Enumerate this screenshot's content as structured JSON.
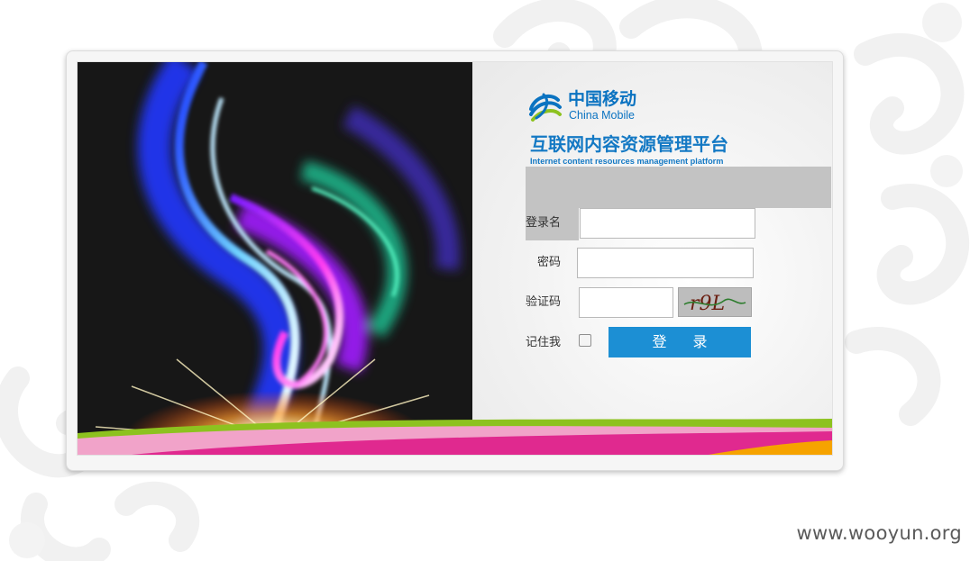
{
  "brand": {
    "name_cn": "中国移动",
    "name_en": "China Mobile"
  },
  "platform": {
    "title_cn": "互联网内容资源管理平台",
    "title_en": "Internet content resources management platform"
  },
  "form": {
    "username_label": "登录名",
    "username_value": "",
    "password_label": "密码",
    "password_value": "",
    "captcha_label": "验证码",
    "captcha_value": "",
    "captcha_image_text": "r9L",
    "remember_label": "记住我",
    "remember_checked": false,
    "login_button": "登 录"
  },
  "colors": {
    "brand_blue": "#1479c4",
    "button_blue": "#1c8fd4",
    "banner_grey": "#c3c3c3"
  },
  "watermark": "www.wooyun.org"
}
